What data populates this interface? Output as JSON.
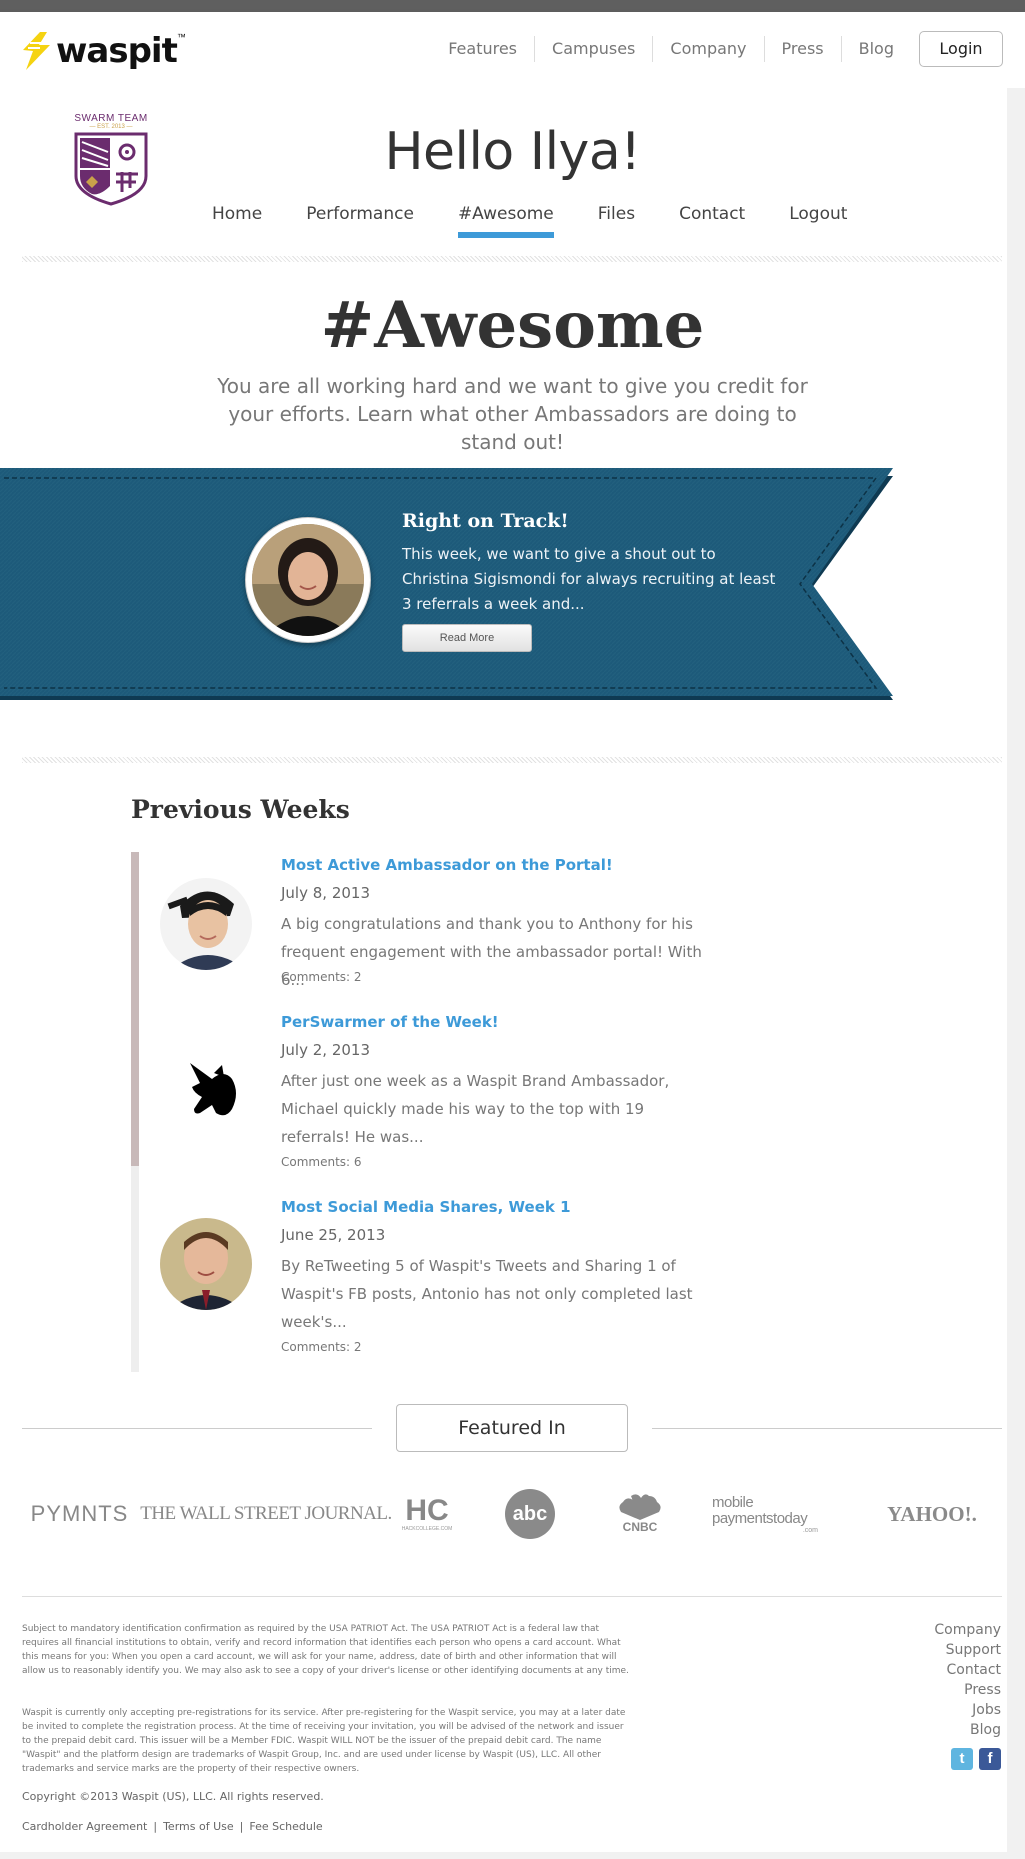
{
  "brand": {
    "name": "waspit",
    "tm": "™",
    "logo_color": "#f5d311"
  },
  "topnav": {
    "items": [
      "Features",
      "Campuses",
      "Company",
      "Press",
      "Blog"
    ],
    "login": "Login"
  },
  "crest": {
    "label": "SWARM TEAM",
    "year": "— EST. 2013 —"
  },
  "greeting": "Hello Ilya!",
  "subnav": {
    "items": [
      "Home",
      "Performance",
      "#Awesome",
      "Files",
      "Contact",
      "Logout"
    ],
    "active": "#Awesome",
    "active_color": "#3d9ad8"
  },
  "page": {
    "title": "#Awesome",
    "subtitle": "You are all working hard and we want to give you credit for your efforts. Learn what other Ambassadors are doing to stand out!"
  },
  "feature": {
    "title": "Right on Track!",
    "text": "This week, we want to give a shout out to Christina Sigismondi for always recruiting at least 3 referrals a week and...",
    "button": "Read More",
    "ribbon_color": "#1d5a7a"
  },
  "previous": {
    "heading": "Previous Weeks",
    "entries": [
      {
        "title": "Most Active Ambassador on the Portal!",
        "date": "July 8, 2013",
        "text": "A big congratulations and thank you to Anthony for his frequent engagement with the ambassador portal! With 6...",
        "comments": "Comments: 2",
        "thumb": "person-photo"
      },
      {
        "title": "PerSwarmer of the Week!",
        "date": "July 2, 2013",
        "text": "After just one week as a Waspit Brand Ambassador, Michael quickly made his way to the top with 19 referrals! He was...",
        "comments": "Comments: 6",
        "thumb": "unicorn-icon"
      },
      {
        "title": "Most Social Media Shares, Week 1",
        "date": "June 25, 2013",
        "text": "By ReTweeting 5 of Waspit's Tweets and Sharing 1 of Waspit's FB posts, Antonio has not only completed last week's...",
        "comments": "Comments: 2",
        "thumb": "person-photo"
      }
    ]
  },
  "featured": {
    "label": "Featured In",
    "logos": [
      "PYMNTS",
      "THE WALL STREET JOURNAL.",
      "HC",
      "abc",
      "CNBC",
      "mobile paymentstoday",
      "YAHOO!."
    ],
    "hc_sub": "HACKCOLLEGE.COM",
    "mpt_sub": ".com"
  },
  "footer": {
    "legal1": "Subject to mandatory identification confirmation as required by the USA PATRIOT Act. The USA PATRIOT Act is a federal law that requires all financial institutions to obtain, verify and record information that identifies each person who opens a card account. What this means for you: When you open a card account, we will ask for your name, address, date of birth and other information that will allow us to reasonably identify you. We may also ask to see a copy of your driver's license or other identifying documents at any time.",
    "legal2": "Waspit is currently only accepting pre-registrations for its service. After pre-registering for the Waspit service, you may at a later date be invited to complete the registration process. At the time of receiving your invitation, you will be advised of the network and issuer to the prepaid debit card. This issuer will be a Member FDIC. Waspit WILL NOT be the issuer of the prepaid debit card. The name \"Waspit\" and the platform design are trademarks of Waspit Group, Inc. and are used under license by Waspit (US), LLC. All other trademarks and service marks are the property of their respective owners.",
    "copyright": "Copyright ©2013 Waspit (US), LLC. All rights reserved.",
    "legal_links": [
      "Cardholder Agreement",
      "Terms of Use",
      "Fee Schedule"
    ],
    "links": [
      "Company",
      "Support",
      "Contact",
      "Press",
      "Jobs",
      "Blog"
    ],
    "social": {
      "twitter": "twitter-icon",
      "facebook": "facebook-icon",
      "twitter_color": "#5fb5e0",
      "facebook_color": "#3b5998"
    }
  }
}
